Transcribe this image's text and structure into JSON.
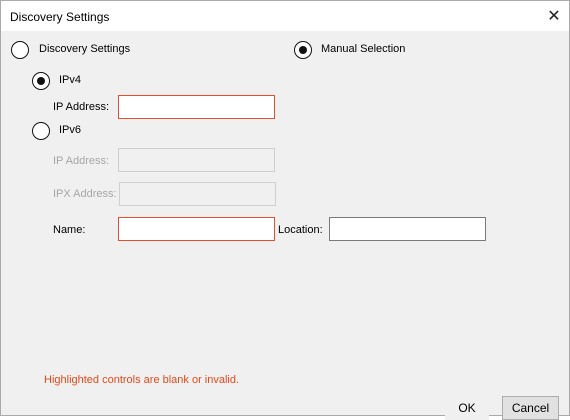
{
  "window": {
    "title": "Discovery Settings"
  },
  "mode": {
    "discovery_label": "Discovery Settings",
    "manual_label": "Manual Selection",
    "selected": "manual"
  },
  "protocol": {
    "ipv4_label": "IPv4",
    "ipv6_label": "IPv6",
    "selected": "ipv4"
  },
  "ipv4": {
    "ip_label": "IP Address:",
    "ip_value": ""
  },
  "ipv6": {
    "ip_label": "IP Address:",
    "ip_value": "",
    "ipx_label": "IPX Address:",
    "ipx_value": ""
  },
  "fields": {
    "name_label": "Name:",
    "name_value": "",
    "location_label": "Location:",
    "location_value": ""
  },
  "error_message": "Highlighted controls are blank or invalid.",
  "buttons": {
    "ok": "OK",
    "cancel": "Cancel"
  },
  "colors": {
    "error": "#e24a1a",
    "invalid_border": "#e2502a"
  }
}
